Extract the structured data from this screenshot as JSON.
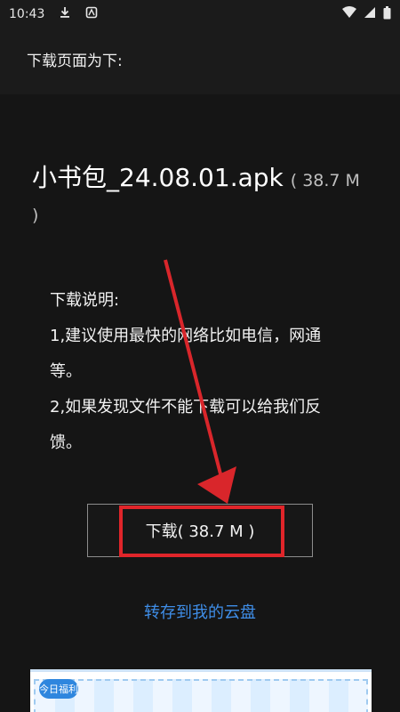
{
  "status_bar": {
    "time": "10:43"
  },
  "header": {
    "title": "下载页面为下:"
  },
  "file": {
    "name": "小书包_24.08.01.apk",
    "size_text": "( 38.7 M )"
  },
  "instructions": {
    "heading": "下载说明:",
    "line1": "1,建议使用最快的网络比如电信，网通等。",
    "line2": "2,如果发现文件不能下载可以给我们反馈。"
  },
  "download_button": {
    "label": "下载( 38.7 M )"
  },
  "save_link": {
    "label": "转存到我的云盘"
  },
  "ad": {
    "badge": "今日福利"
  },
  "colors": {
    "link": "#3f8ee8",
    "highlight": "#e0252a"
  }
}
